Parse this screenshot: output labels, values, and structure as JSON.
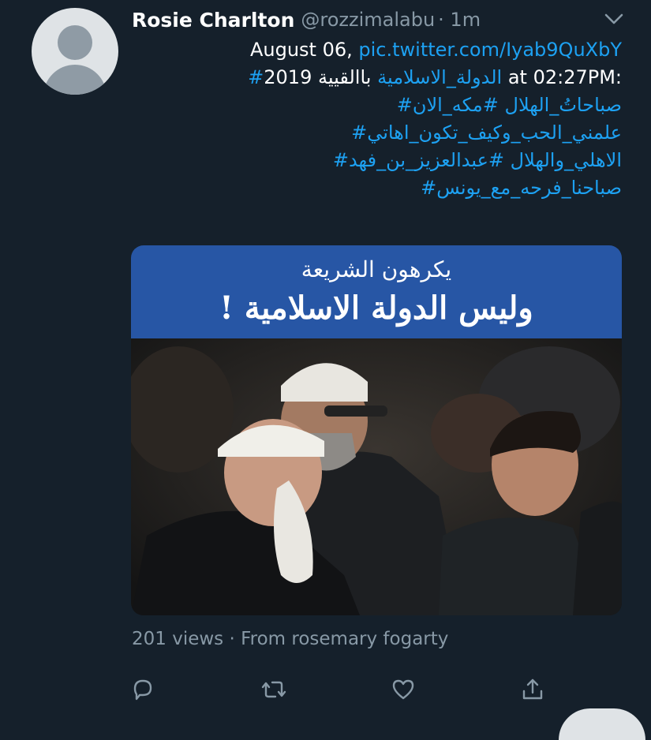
{
  "user": {
    "name": "Rosie Charlton",
    "handle": "@rozzimalabu",
    "time": "· 1m"
  },
  "tweet": {
    "line1_date": "August 06,",
    "line1_link": "pic.twitter.com/Iyab9QuXbY",
    "line2_tag": "#الدولة_الاسلامية",
    "line2_text": "باالقيية 2019 at 02:27PM:",
    "line3": "#صباحاتُ_الهلال #مكه_الان",
    "line4": "#علمني_الحب_وكيف_تكون_اهاتي",
    "line5": "#الاهلي_والهلال #عبدالعزيز_بن_فهد",
    "line6": "#صباحنا_فرحه_مع_يونس"
  },
  "media": {
    "banner_line1": "يكرهون الشريعة",
    "banner_line2": "وليس الدولة الاسلامية !"
  },
  "meta": {
    "views": "201 views",
    "source": "· From rosemary fogarty"
  },
  "actions": [
    {
      "name": "reply-icon"
    },
    {
      "name": "retweet-icon"
    },
    {
      "name": "like-icon"
    },
    {
      "name": "share-icon"
    }
  ],
  "colors": {
    "background": "#15202b",
    "link": "#1da1f2",
    "secondary_text": "#8899a6",
    "banner": "#2756a5"
  }
}
